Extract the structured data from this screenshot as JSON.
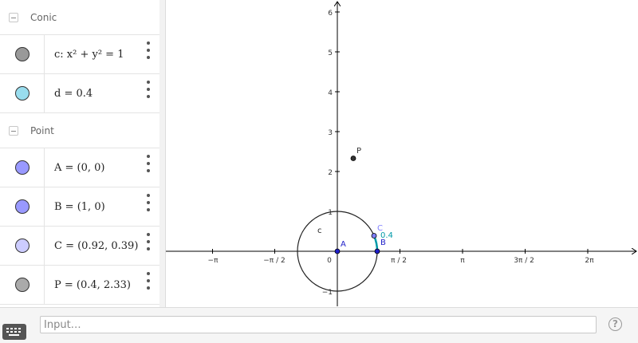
{
  "algebra": {
    "groups": [
      {
        "label": "Conic",
        "items": [
          {
            "text": "c: x² + y² = 1",
            "color": "#999999"
          },
          {
            "text": "d = 0.4",
            "color": "#99ddee"
          }
        ]
      },
      {
        "label": "Point",
        "items": [
          {
            "text": "A = (0, 0)",
            "color": "#9999ff"
          },
          {
            "text": "B = (1, 0)",
            "color": "#9999ff"
          },
          {
            "text": "C = (0.92, 0.39)",
            "color": "#ccccff"
          },
          {
            "text": "P = (0.4, 2.33)",
            "color": "#aaaaaa"
          }
        ]
      }
    ]
  },
  "graphics": {
    "x_ticks": [
      "−π",
      "−π / 2",
      "0",
      "π / 2",
      "π",
      "3π / 2",
      "2π"
    ],
    "y_ticks": [
      "−1",
      "1",
      "2",
      "3",
      "4",
      "5",
      "6"
    ],
    "points": {
      "A": {
        "label": "A",
        "x": 0,
        "y": 0,
        "color": "#1e1ec8"
      },
      "B": {
        "label": "B",
        "x": 1,
        "y": 0,
        "color": "#1e1ec8"
      },
      "C": {
        "label": "C",
        "x": 0.92,
        "y": 0.39,
        "color": "#7f7fff"
      },
      "P": {
        "label": "P",
        "x": 0.4,
        "y": 2.33,
        "color": "#333333"
      }
    },
    "circle_label": "c",
    "arc_label": "0.4",
    "arc_color": "#0099a8"
  },
  "inputbar": {
    "placeholder": "Input…",
    "help_label": "?"
  }
}
